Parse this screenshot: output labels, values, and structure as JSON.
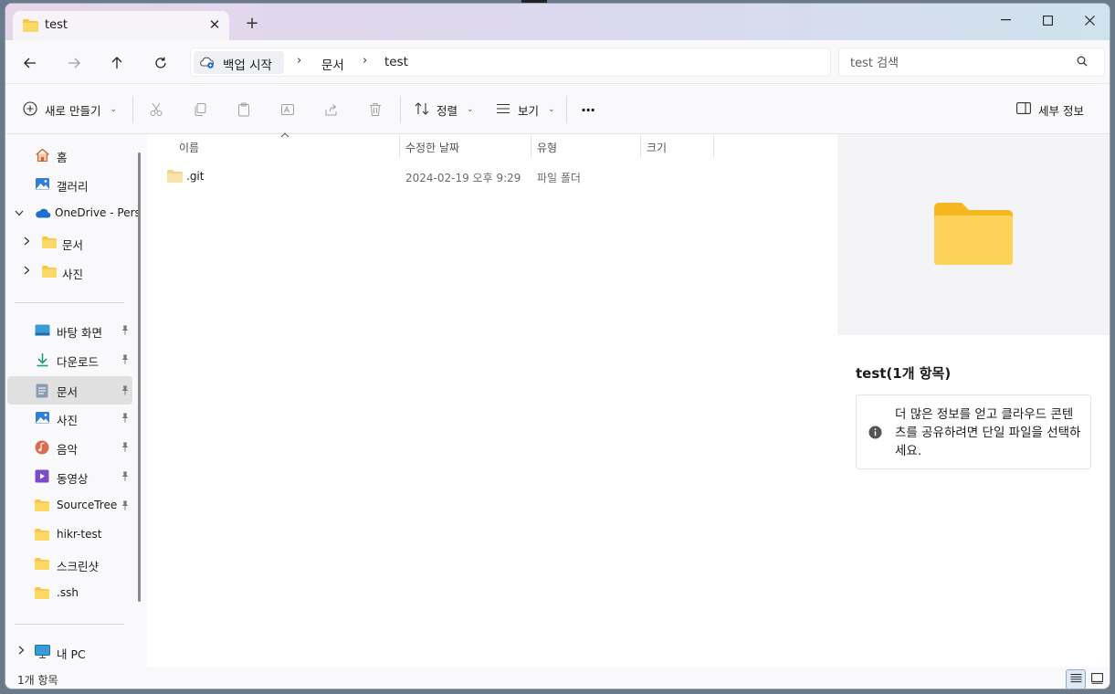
{
  "window": {
    "tab_title": "test",
    "new_tab": "+",
    "close_tab": "✕",
    "controls": {
      "minimize": "—",
      "maximize": "☐",
      "close": "✕"
    }
  },
  "nav": {
    "breadcrumbs": [
      {
        "label": "백업 시작",
        "icon": "cloud-sync-icon"
      },
      {
        "label": "문서"
      },
      {
        "label": "test"
      }
    ],
    "search_placeholder": "test 검색"
  },
  "toolbar": {
    "new_label": "새로 만들기",
    "sort_label": "정렬",
    "view_label": "보기",
    "more_label": "···",
    "details_label": "세부 정보"
  },
  "sidebar": {
    "top_items": [
      {
        "label": "홈",
        "icon": "home-icon"
      },
      {
        "label": "갤러리",
        "icon": "gallery-icon"
      },
      {
        "label": "OneDrive - Pers",
        "icon": "onedrive-icon",
        "expanded": true
      },
      {
        "label": "문서",
        "icon": "folder-icon"
      },
      {
        "label": "사진",
        "icon": "folder-icon"
      }
    ],
    "pinned_items": [
      {
        "label": "바탕 화면",
        "icon": "desktop-icon",
        "pinned": true
      },
      {
        "label": "다운로드",
        "icon": "download-icon",
        "pinned": true
      },
      {
        "label": "문서",
        "icon": "documents-icon",
        "pinned": true,
        "selected": true
      },
      {
        "label": "사진",
        "icon": "pictures-icon",
        "pinned": true
      },
      {
        "label": "음악",
        "icon": "music-icon",
        "pinned": true
      },
      {
        "label": "동영상",
        "icon": "video-icon",
        "pinned": true
      },
      {
        "label": "SourceTree",
        "icon": "folder-icon",
        "pinned": true
      },
      {
        "label": "hikr-test",
        "icon": "folder-icon"
      },
      {
        "label": "스크린샷",
        "icon": "folder-icon"
      },
      {
        "label": ".ssh",
        "icon": "folder-icon"
      }
    ],
    "pc_item": {
      "label": "내 PC",
      "icon": "pc-icon"
    }
  },
  "file_list": {
    "columns": [
      "이름",
      "수정한 날짜",
      "유형",
      "크기"
    ],
    "rows": [
      {
        "name": ".git",
        "modified": "2024-02-19 오후 9:29",
        "type": "파일 폴더",
        "size": ""
      }
    ]
  },
  "details_pane": {
    "title": "test(1개 항목)",
    "info": "더 많은 정보를 얻고 클라우드 콘텐츠를 공유하려면 단일 파일을 선택하세요."
  },
  "status": {
    "item_count": "1개 항목"
  },
  "colors": {
    "folder": "#f8c640",
    "folder_light": "#fcd867",
    "onedrive": "#1f6fd0",
    "selected_bg": "#e0e0e0"
  }
}
